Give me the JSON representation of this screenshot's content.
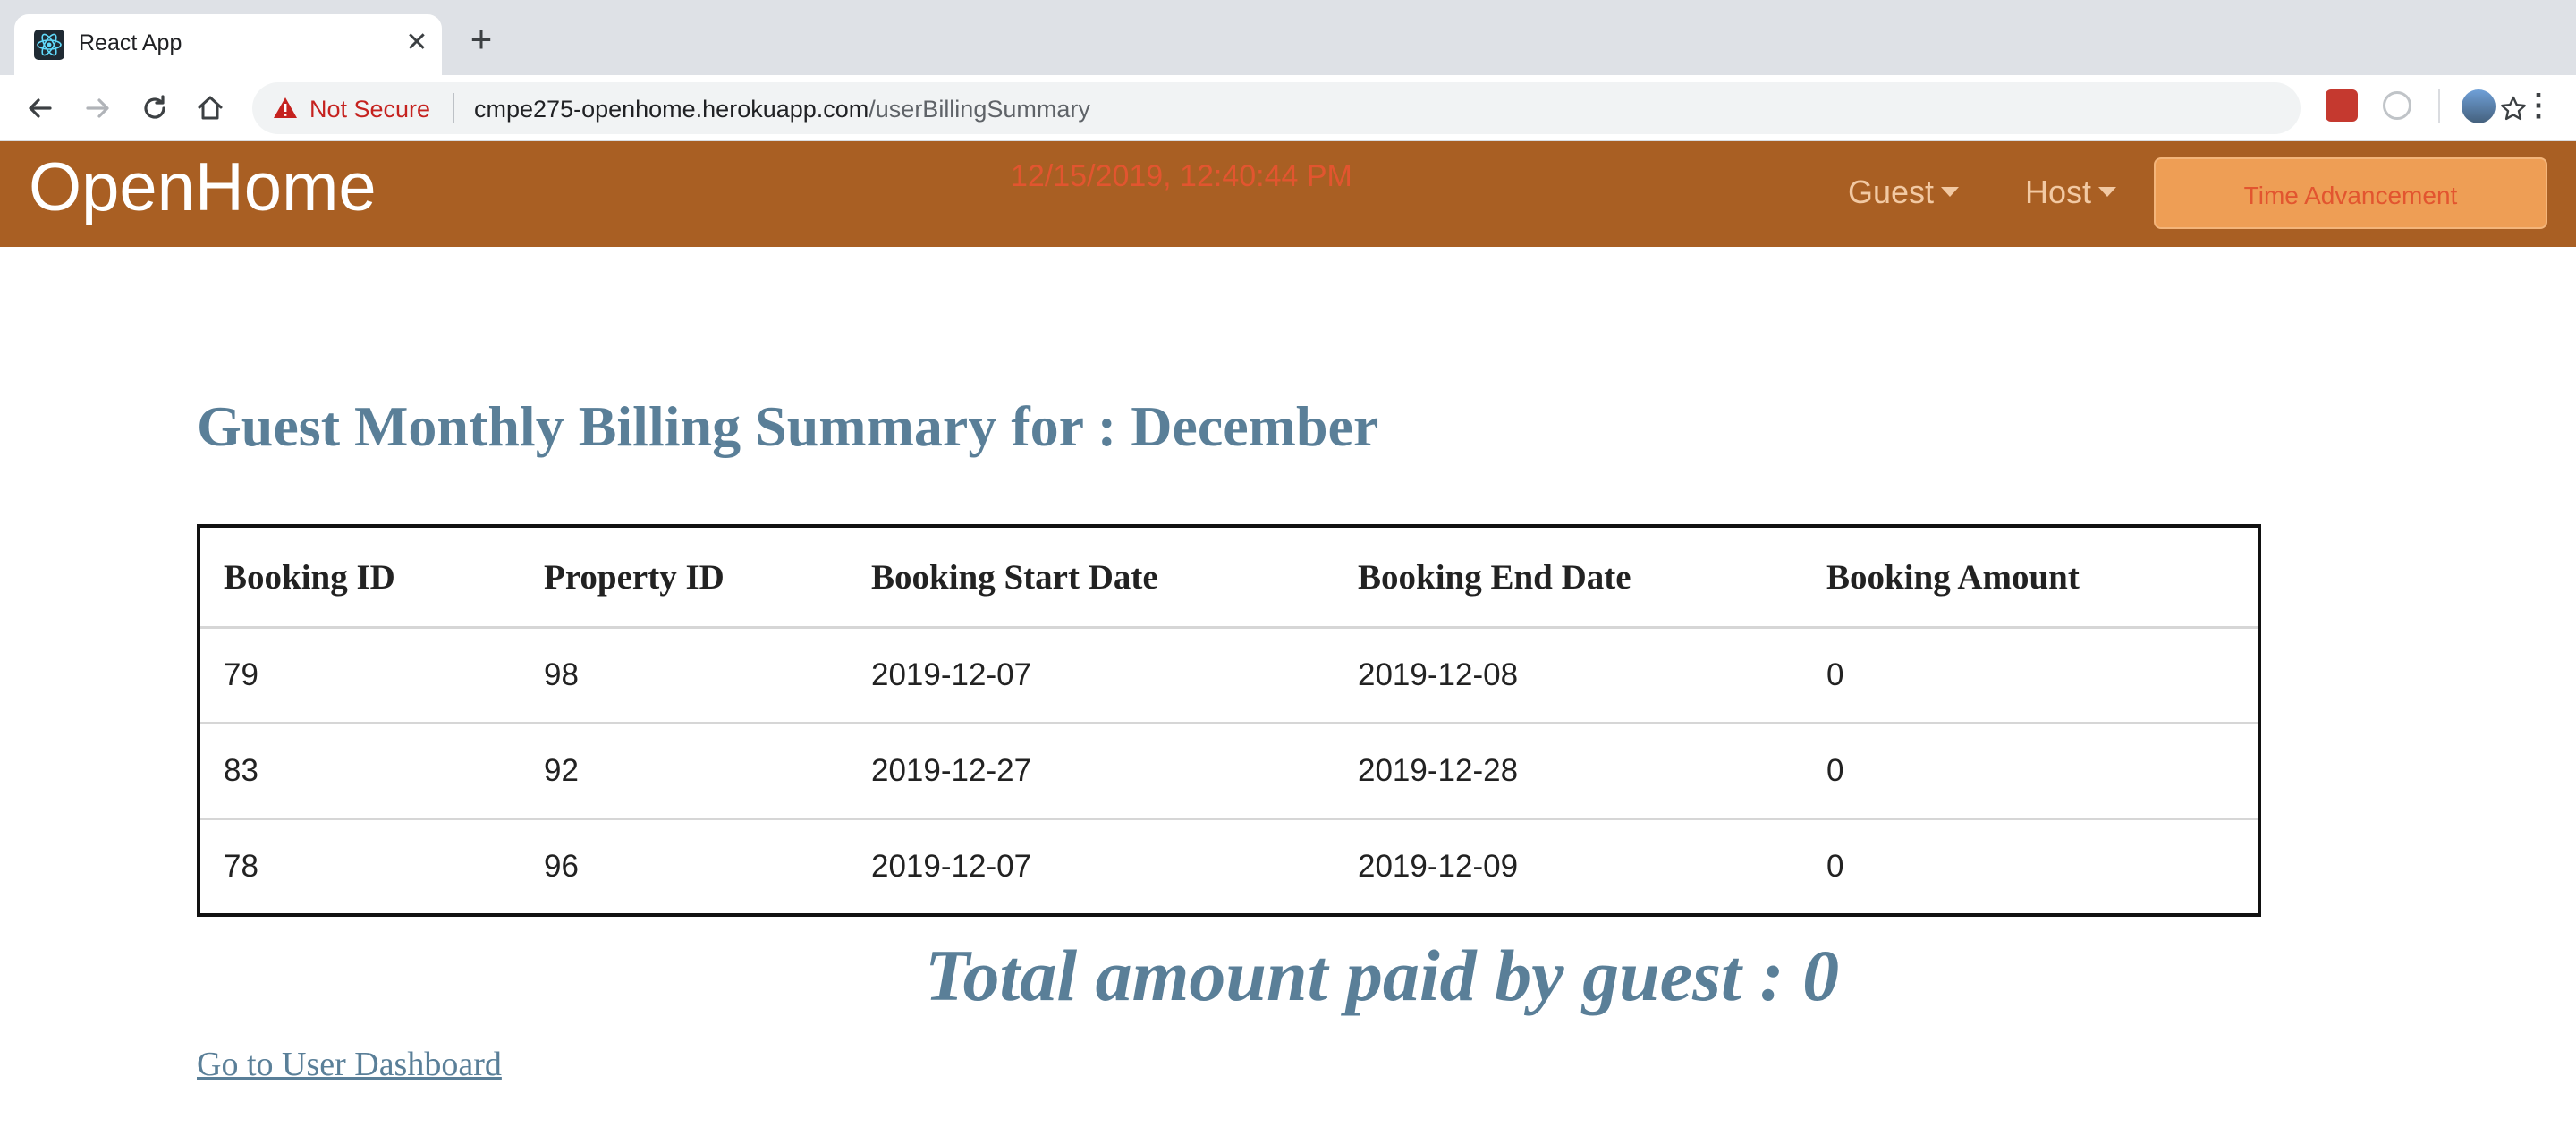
{
  "browser": {
    "tab_title": "React App",
    "tab_close": "✕",
    "new_tab": "+",
    "security_label": "Not Secure",
    "url_host": "cmpe275-openhome.herokuapp.com",
    "url_path": "/userBillingSummary",
    "menu": "⋮"
  },
  "navbar": {
    "brand": "OpenHome",
    "datetime": "12/15/2019, 12:40:44 PM",
    "guest_menu": "Guest",
    "host_menu": "Host",
    "time_advancement": "Time Advancement",
    "colors": {
      "background": "#a95f23",
      "button": "#ee9e55",
      "clock": "#e2552f"
    }
  },
  "page": {
    "heading": "Guest Monthly Billing Summary for : December",
    "table": {
      "headers": [
        "Booking ID",
        "Property ID",
        "Booking Start Date",
        "Booking End Date",
        "Booking Amount"
      ],
      "rows": [
        [
          "79",
          "98",
          "2019-12-07",
          "2019-12-08",
          "0"
        ],
        [
          "83",
          "92",
          "2019-12-27",
          "2019-12-28",
          "0"
        ],
        [
          "78",
          "96",
          "2019-12-07",
          "2019-12-09",
          "0"
        ]
      ]
    },
    "total": "Total amount paid by guest : 0",
    "dashboard_link": "Go to User Dashboard",
    "accent_color": "#5a7f98"
  }
}
